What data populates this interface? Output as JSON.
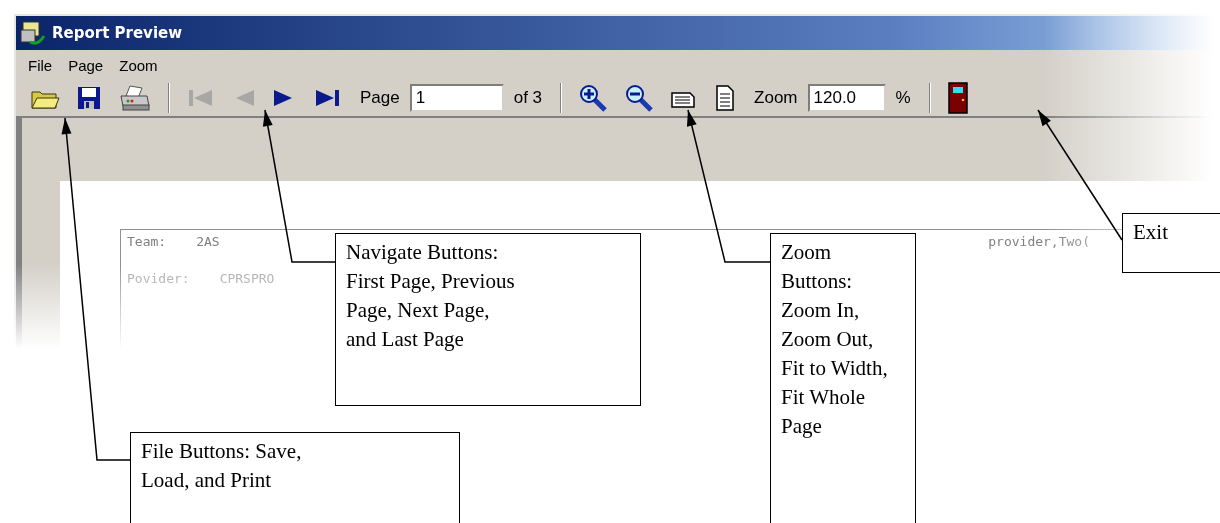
{
  "window": {
    "title": "Report Preview"
  },
  "menu": [
    {
      "label": "File"
    },
    {
      "label": "Page"
    },
    {
      "label": "Zoom"
    }
  ],
  "toolbar": [
    {
      "kind": "open",
      "disabled": false
    },
    {
      "kind": "save",
      "disabled": false
    },
    {
      "kind": "print",
      "disabled": false
    },
    {
      "kind": "separator"
    },
    {
      "kind": "first",
      "disabled": true
    },
    {
      "kind": "prev",
      "disabled": true
    },
    {
      "kind": "next",
      "disabled": false
    },
    {
      "kind": "last",
      "disabled": false
    },
    {
      "kind": "label",
      "text": "Page"
    },
    {
      "kind": "pagefield",
      "value": "1"
    },
    {
      "kind": "label",
      "text": "of 3"
    },
    {
      "kind": "separator"
    },
    {
      "kind": "zoomin",
      "disabled": false
    },
    {
      "kind": "zoomout",
      "disabled": false
    },
    {
      "kind": "fitwidth",
      "disabled": false
    },
    {
      "kind": "fitpage",
      "disabled": false
    },
    {
      "kind": "label",
      "text": "Zoom"
    },
    {
      "kind": "zoomfield",
      "value": "120.0"
    },
    {
      "kind": "label",
      "text": "%"
    },
    {
      "kind": "separator"
    },
    {
      "kind": "exit",
      "disabled": false
    }
  ],
  "report": {
    "team_label": "Team:",
    "team_value": "2AS",
    "provider_label": "Povider:",
    "provider_value": "CPRSPRO",
    "column_3": "provider,Two("
  },
  "callouts": [
    {
      "lines": [
        "Navigate Buttons:",
        "First Page, Previous",
        "Page, Next Page,",
        "and Last Page"
      ]
    },
    {
      "lines": [
        "File Buttons: Save,",
        "Load, and Print"
      ]
    },
    {
      "lines": [
        "Zoom",
        "Buttons:",
        "Zoom In,",
        "Zoom Out,",
        "Fit to Width,",
        "Fit Whole",
        "Page"
      ]
    },
    {
      "lines": [
        "Exit"
      ]
    }
  ]
}
